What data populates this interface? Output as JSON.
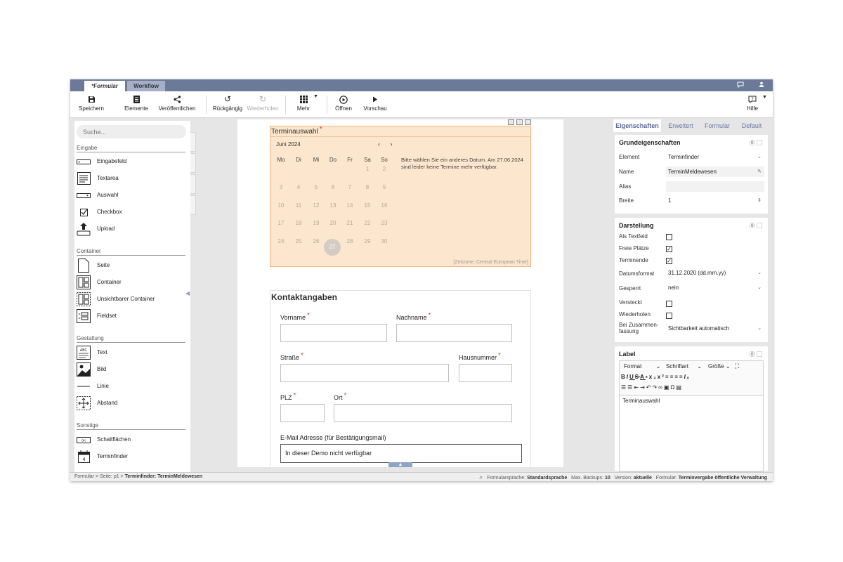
{
  "tabs": {
    "formular": "*Formular",
    "workflow": "Workflow"
  },
  "toolbar": {
    "save": "Speichern",
    "elements": "Elemente",
    "publish": "Veröffentlichen",
    "undo": "Rückgängig",
    "redo": "Wiederholen",
    "more": "Mehr",
    "open": "Öffnen",
    "preview": "Vorschau",
    "help": "Hilfe"
  },
  "palette": {
    "search_placeholder": "Suche...",
    "sections": {
      "eingabe": "Eingabe",
      "container": "Container",
      "gestaltung": "Gestaltung",
      "sonstige": "Sonstige"
    },
    "eingabe": [
      "Eingabefeld",
      "Textarea",
      "Auswahl",
      "Checkbox",
      "Upload"
    ],
    "container": [
      "Seite",
      "Container",
      "Unsichtbarer Container",
      "Fieldset"
    ],
    "gestaltung": [
      "Text",
      "Bild",
      "Linie",
      "Abstand"
    ],
    "sonstige": [
      "Schaltflächen",
      "Terminfinder"
    ]
  },
  "termin": {
    "title": "Terminauswahl",
    "required": "*",
    "month": "Juni 2024",
    "nav": "‹ ›",
    "weekdays": [
      "Mo",
      "Di",
      "Mi",
      "Do",
      "Fr",
      "Sa",
      "So"
    ],
    "weeks": [
      [
        "",
        "",
        "",
        "",
        "",
        "1",
        "2"
      ],
      [
        "3",
        "4",
        "5",
        "6",
        "7",
        "8",
        "9"
      ],
      [
        "10",
        "11",
        "12",
        "13",
        "14",
        "15",
        "16"
      ],
      [
        "17",
        "18",
        "19",
        "20",
        "21",
        "22",
        "23"
      ],
      [
        "24",
        "25",
        "26",
        "27",
        "28",
        "29",
        "30"
      ]
    ],
    "selected_day": "27",
    "info": "Bitte wählen Sie ein anderes Datum. Am 27.06.2024 sind leider keine Termine mehr verfügbar.",
    "timezone": "[Zeitzone: Central European Time]"
  },
  "contact": {
    "title": "Kontaktangaben",
    "vorname": "Vorname",
    "nachname": "Nachname",
    "strasse": "Straße",
    "hausnummer": "Hausnummer",
    "plz": "PLZ",
    "ort": "Ort",
    "email_label": "E-Mail Adresse (für Bestätigungsmail)",
    "email_value": "In dieser Demo nicht verfügbar",
    "required": "*"
  },
  "props": {
    "tabs": [
      "Eigenschaften",
      "Erweitert",
      "Formular",
      "Default"
    ],
    "grund": {
      "title": "Grundeigenschaften",
      "element_label": "Element",
      "element_value": "Terminfinder",
      "name_label": "Name",
      "name_value": "TerminMeldewesen",
      "alias_label": "Alias",
      "alias_value": "",
      "breite_label": "Breite",
      "breite_value": "1"
    },
    "darstellung": {
      "title": "Darstellung",
      "als_textfeld": "Als Textfeld",
      "freie_plaetze": "Freie Plätze",
      "terminende": "Terminende",
      "datumsformat_label": "Datumsformat",
      "datumsformat_value": "31.12.2020 (dd.mm.yy)",
      "gesperrt_label": "Gesperrt",
      "gesperrt_value": "nein",
      "versteckt": "Versteckt",
      "wiederholen": "Wiederholen",
      "zusammenfassung_label": "Bei Zusammen-fassung",
      "zusammenfassung_value": "Sichtbarkeit automatisch"
    },
    "label": {
      "title": "Label",
      "format": "Format",
      "schriftart": "Schriftart",
      "groesse": "Größe",
      "content": "Terminauswahl"
    }
  },
  "status": {
    "breadcrumb_prefix": "Formular > Seite: p1 > ",
    "breadcrumb_current": "Terminfinder: TerminMeldewesen",
    "sprache_label": "Formularsprache:",
    "sprache_value": "Standardsprache",
    "backups_label": "Max. Backups:",
    "backups_value": "10",
    "version_label": "Version:",
    "version_value": "aktuelle",
    "formular_label": "Formular:",
    "formular_value": "Terminvergabe öffentliche Verwaltung"
  }
}
